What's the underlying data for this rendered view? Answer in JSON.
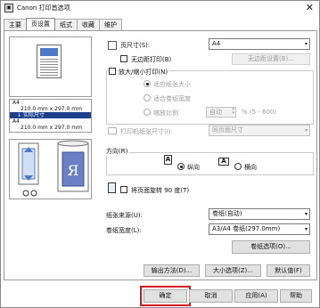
{
  "window": {
    "brand": "Canon",
    "title": "打印首选项",
    "close": "✕"
  },
  "tabs": [
    "主要",
    "页设置",
    "纸式",
    "收藏",
    "维护"
  ],
  "preview": {
    "info_lines": [
      "A4 :",
      "210.0 mm x 297.0 mm",
      "实际尺寸",
      "A4",
      "210.0 mm x 297.0 mm"
    ]
  },
  "page_size": {
    "label": "页尺寸(S):",
    "value": "A4"
  },
  "borderless": {
    "label": "无边距打印(B)"
  },
  "borderless_settings": {
    "label": "无边距设置(B)..."
  },
  "scale": {
    "label": "放大/缩小打印(N)",
    "fit_paper": "适应纸张大小",
    "fit_width": "适合卷纸宽度",
    "ratio": "缩放比例",
    "auto": "自动",
    "range": "% (5 - 600)"
  },
  "output_size": {
    "label": "打印机纸张尺寸(I):",
    "value": "同页面尺寸"
  },
  "orientation": {
    "label": "方向(R)",
    "portrait": "纵向",
    "landscape": "横向",
    "rotate": "将页面旋转 90 度(T)"
  },
  "paper_source": {
    "label": "纸张来源(U):",
    "value": "卷纸(自动)"
  },
  "roll_width": {
    "label": "卷纸宽度(L):",
    "value": "A3/A4 卷纸(297.0mm)"
  },
  "roll_options": {
    "label": "卷纸选项(O)..."
  },
  "bottom_buttons": {
    "output_method": "输出方法(D)...",
    "size_options": "大小选项(Z)...",
    "defaults": "默认值(F)"
  },
  "dialog_buttons": {
    "ok": "确定",
    "cancel": "取消",
    "apply": "应用(A)",
    "help": "帮助"
  },
  "colors": {
    "highlight": "#d61a1a",
    "selection": "#1e3f8a",
    "accent_blue": "#4f7ac8"
  }
}
